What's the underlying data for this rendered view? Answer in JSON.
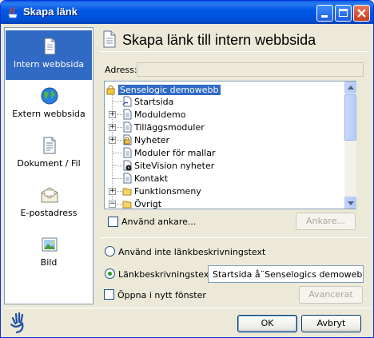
{
  "window": {
    "title": "Skapa länk"
  },
  "sidebar": {
    "items": [
      {
        "label": "Intern webbsida",
        "icon": "page-icon",
        "selected": true
      },
      {
        "label": "Extern webbsida",
        "icon": "globe-icon"
      },
      {
        "label": "Dokument / Fil",
        "icon": "document-icon"
      },
      {
        "label": "E-postadress",
        "icon": "envelope-icon"
      },
      {
        "label": "Bild",
        "icon": "image-icon"
      }
    ]
  },
  "header": {
    "title": "Skapa länk till intern webbsida",
    "icon": "page-icon"
  },
  "address": {
    "label": "Adress:",
    "value": ""
  },
  "tree": {
    "root": "Senselogic demowebb",
    "items": [
      {
        "label": "Startsida",
        "icon": "link-page-icon",
        "expandable": false
      },
      {
        "label": "Moduldemo",
        "icon": "page-icon",
        "expandable": true
      },
      {
        "label": "Tilläggsmoduler",
        "icon": "page-icon",
        "expandable": true
      },
      {
        "label": "Nyheter",
        "icon": "lock-page-icon",
        "expandable": true
      },
      {
        "label": "Moduler för mallar",
        "icon": "page-icon",
        "expandable": false
      },
      {
        "label": "SiteVision nyheter",
        "icon": "info-page-icon",
        "expandable": false
      },
      {
        "label": "Kontakt",
        "icon": "page-icon",
        "expandable": false
      },
      {
        "label": "Funktionsmeny",
        "icon": "folder-icon",
        "expandable": true
      },
      {
        "label": "Övrigt",
        "icon": "folder-icon",
        "expandable": true
      }
    ]
  },
  "options": {
    "anchor_label": "Använd ankare...",
    "anchor_button": "Ankare...",
    "no_desc_label": "Använd inte länkbeskrivningstext",
    "desc_label": "Länkbeskrivningstext:",
    "desc_value": "Startsida å¨Senselogics demowebb",
    "new_window_label": "Öppna i nytt fönster",
    "advanced_button": "Avancerat"
  },
  "footer": {
    "ok": "OK",
    "cancel": "Avbryt"
  },
  "colors": {
    "titlebar": "#0058e6",
    "selection": "#316ac5",
    "face": "#ece9d8"
  }
}
